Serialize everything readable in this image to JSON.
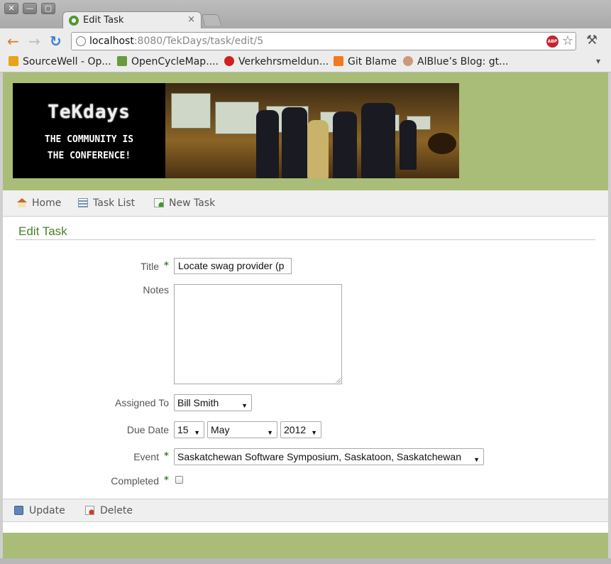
{
  "window": {
    "buttons": [
      "✕",
      "—",
      "▢"
    ]
  },
  "tab": {
    "title": "Edit Task",
    "close": "×"
  },
  "toolbar": {
    "back": "←",
    "forward": "→",
    "reload": "↻",
    "url_host": "localhost",
    "url_path": ":8080/TekDays/task/edit/5",
    "abp": "ABP",
    "star": "☆",
    "wrench": "🔧"
  },
  "bookmarks": [
    {
      "label": "SourceWell - Op...",
      "color": "#e8a317"
    },
    {
      "label": "OpenCycleMap....",
      "color": "#6a9a3a"
    },
    {
      "label": "Verkehrsmeldun...",
      "color": "#d02020"
    },
    {
      "label": "Git Blame",
      "color": "#f07a1e"
    },
    {
      "label": "AlBlue’s Blog: gt...",
      "color": "#c99a7a"
    }
  ],
  "bookmarks_more": "▾",
  "header": {
    "brand": "TeKdays",
    "tagline_1": "THE COMMUNITY IS",
    "tagline_2": "THE CONFERENCE!"
  },
  "nav": {
    "home": "Home",
    "task_list": "Task List",
    "new_task": "New Task"
  },
  "page_title": "Edit Task",
  "form": {
    "title_label": "Title",
    "title_value": "Locate swag provider (p",
    "notes_label": "Notes",
    "notes_value": "",
    "assigned_label": "Assigned To",
    "assigned_value": "Bill Smith",
    "due_label": "Due Date",
    "due_day": "15",
    "due_month": "May",
    "due_year": "2012",
    "event_label": "Event",
    "event_value": "Saskatchewan Software Symposium, Saskatoon, Saskatchewan",
    "completed_label": "Completed",
    "completed_value": false,
    "required_mark": "*"
  },
  "actions": {
    "update": "Update",
    "delete": "Delete"
  },
  "colors": {
    "accent_green": "#48802c",
    "header_bg": "#a9bd78"
  }
}
